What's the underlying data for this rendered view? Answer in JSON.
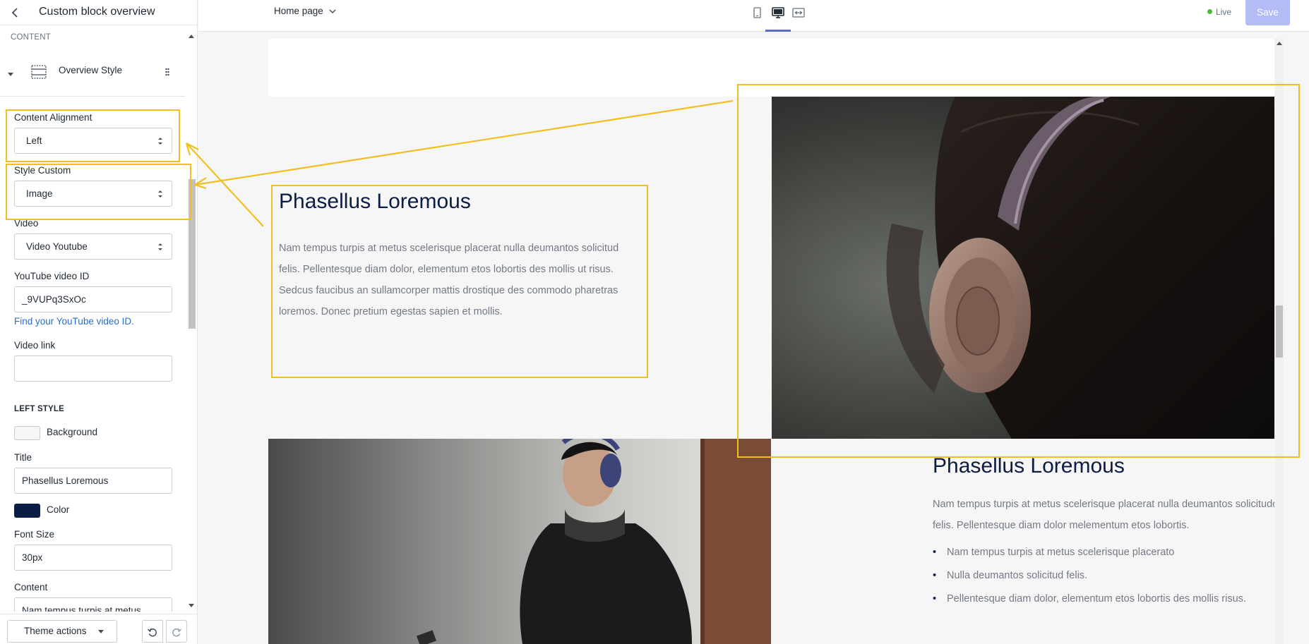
{
  "sidebar": {
    "title": "Custom block overview",
    "content_heading": "CONTENT",
    "block_name": "Overview Style",
    "content_alignment": {
      "label": "Content Alignment",
      "value": "Left"
    },
    "style_custom": {
      "label": "Style Custom",
      "value": "Image"
    },
    "video": {
      "label": "Video",
      "value": "Video Youtube"
    },
    "youtube_id": {
      "label": "YouTube video ID",
      "value": "_9VUPq3SxOc"
    },
    "find_link": "Find your YouTube video ID.",
    "video_link": {
      "label": "Video link",
      "value": ""
    },
    "left_style_heading": "LEFT STYLE",
    "background": {
      "label": "Background",
      "color": "#f6f6f6"
    },
    "title_field": {
      "label": "Title",
      "value": "Phasellus Loremous"
    },
    "color": {
      "label": "Color",
      "color": "#0b1c45"
    },
    "font_size": {
      "label": "Font Size",
      "value": "30px"
    },
    "content_field": {
      "label": "Content",
      "value": "Nam tempus turpis at metus"
    },
    "theme_actions": "Theme actions"
  },
  "topbar": {
    "page": "Home page",
    "status": "Live",
    "save": "Save"
  },
  "preview": {
    "block1": {
      "title": "Phasellus Loremous",
      "text": "Nam tempus turpis at metus scelerisque placerat nulla deumantos solicitud felis. Pellentesque diam dolor, elementum etos lobortis des mollis ut risus. Sedcus faucibus an sullamcorper mattis drostique des commodo pharetras loremos. Donec pretium egestas sapien et mollis."
    },
    "block2": {
      "title": "Phasellus Loremous",
      "text": "Nam tempus turpis at metus scelerisque placerat nulla deumantos solicitudo felis. Pellentesque diam dolor melementum etos lobortis.",
      "bullets": [
        "Nam tempus turpis at metus scelerisque placerato",
        "Nulla deumantos solicitud felis.",
        "Pellentesque diam dolor, elementum etos lobortis des mollis risus."
      ]
    }
  },
  "colors": {
    "highlight": "#f2bf21",
    "accent": "#5c6ac4",
    "live": "#50b83c"
  }
}
